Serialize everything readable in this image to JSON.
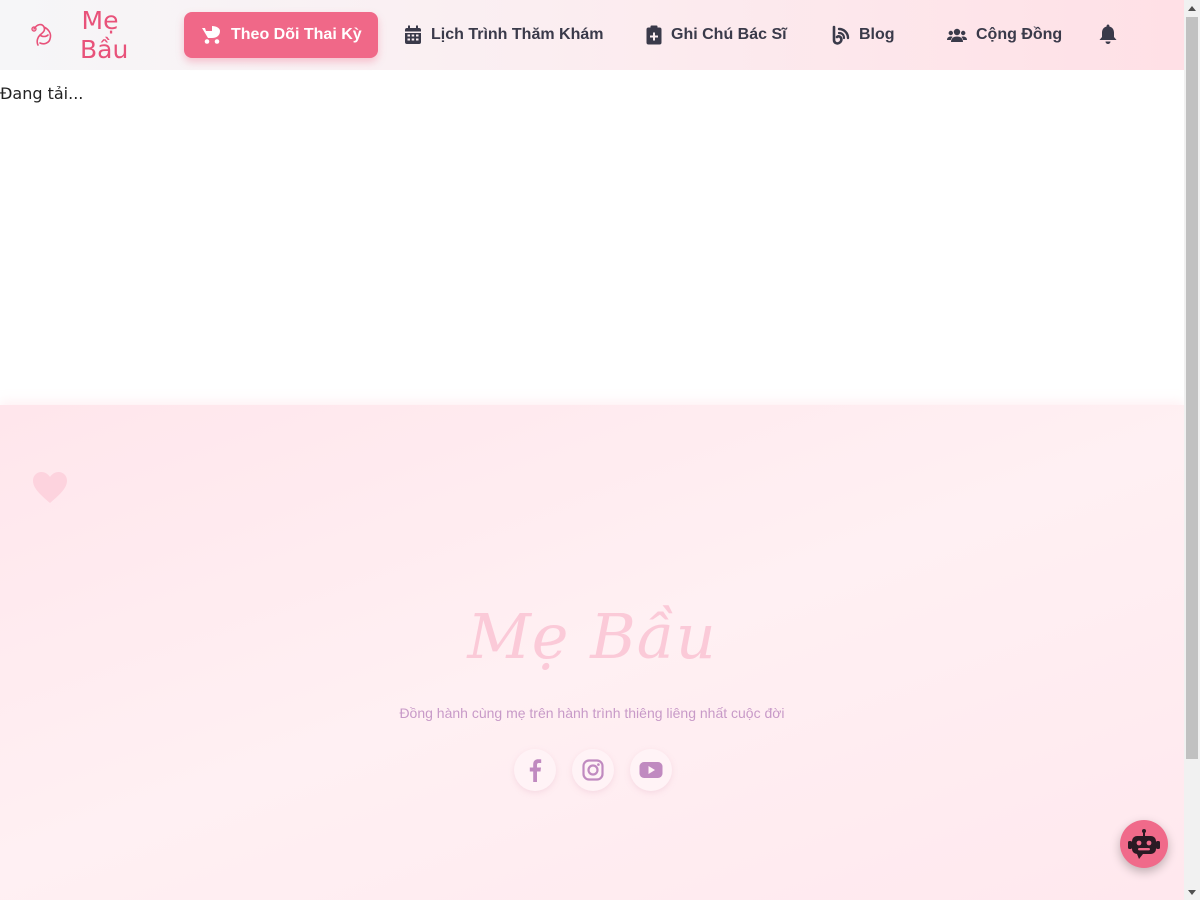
{
  "header": {
    "logo_text": "Mẹ Bầu",
    "nav": [
      {
        "label": "Theo Dõi Thai Kỳ",
        "icon": "baby-carriage-icon",
        "active": true
      },
      {
        "label": "Lịch Trình Thăm Khám",
        "icon": "calendar-icon",
        "active": false
      },
      {
        "label": "Ghi Chú Bác Sĩ",
        "icon": "clipboard-medical-icon",
        "active": false
      },
      {
        "label": "Blog",
        "icon": "blog-icon",
        "active": false
      },
      {
        "label": "Cộng Đồng",
        "icon": "users-icon",
        "active": false
      }
    ],
    "bell_icon": "bell-icon"
  },
  "main": {
    "loading_text": "Đang tải..."
  },
  "footer": {
    "brand": "Mẹ Bầu",
    "tagline": "Đồng hành cùng mẹ trên hành trình thiêng liêng nhất cuộc đời",
    "socials": [
      "facebook-icon",
      "instagram-icon",
      "youtube-icon"
    ]
  },
  "chatbot": {
    "icon": "robot-icon"
  },
  "colors": {
    "accent": "#f06888",
    "brand_pink": "#e8527a",
    "footer_text": "#c89ac8",
    "social_icon": "#c08ac0"
  }
}
